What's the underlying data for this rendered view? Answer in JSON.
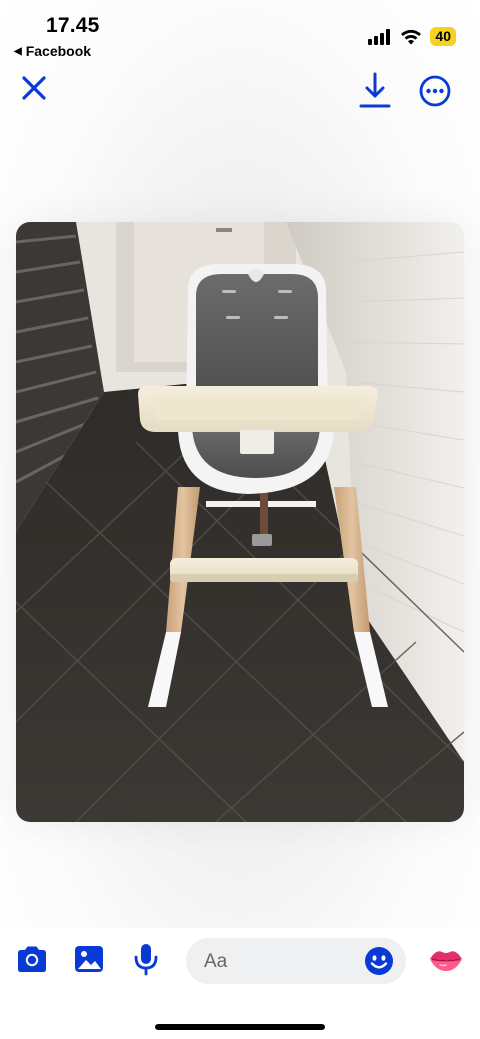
{
  "status_bar": {
    "time": "17.45",
    "back_app_label": "Facebook",
    "battery_level": "40",
    "signal": "signal-bars-icon",
    "wifi": "wifi-icon"
  },
  "top_nav": {
    "close": "close-icon",
    "download": "download-icon",
    "more": "more-options-icon"
  },
  "photo": {
    "subject": "high-chair-photo"
  },
  "bottom_bar": {
    "message_placeholder": "Aa",
    "icons": [
      "camera-icon",
      "gallery-icon",
      "microphone-icon",
      "emoji-icon",
      "lips-icon"
    ]
  },
  "colors": {
    "accent": "#0a3ad6",
    "battery": "#f4d21f",
    "input_bg": "#eff0f2"
  }
}
